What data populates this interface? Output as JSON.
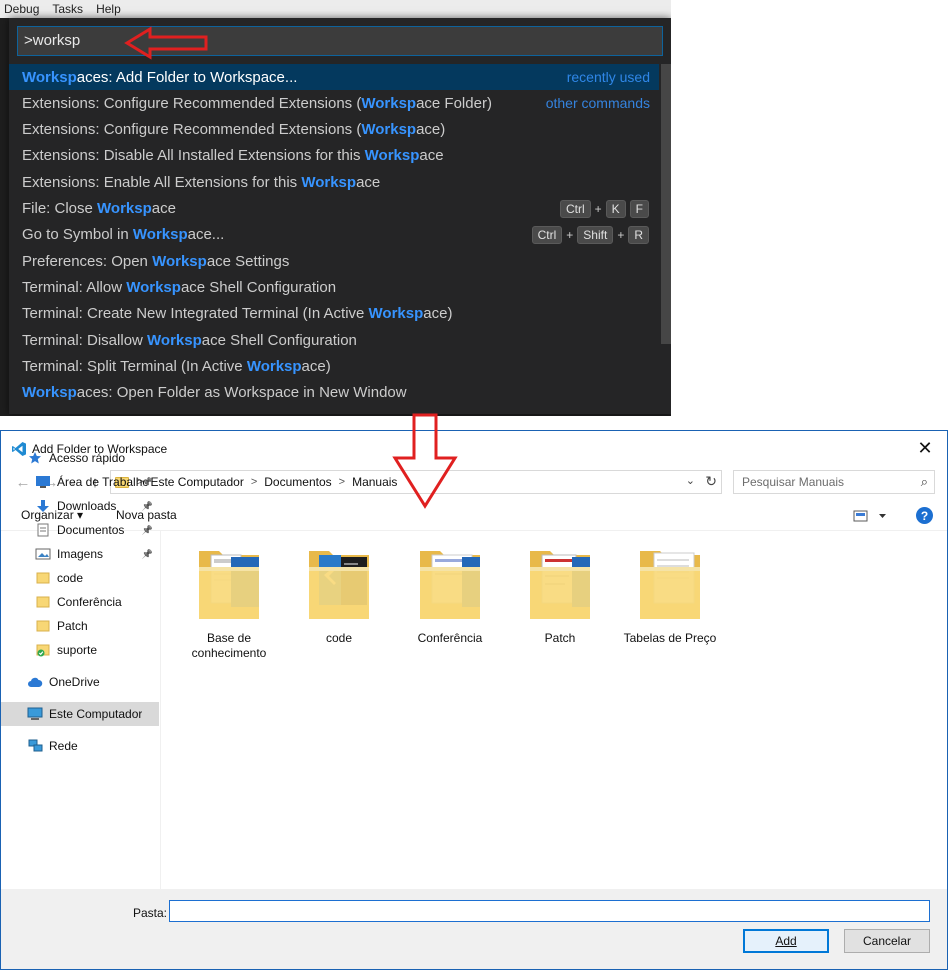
{
  "vscode": {
    "menu": [
      "Debug",
      "Tasks",
      "Help"
    ],
    "input_value": ">worksp",
    "commands": [
      {
        "pre": "",
        "hl": "Worksp",
        "post": "aces: Add Folder to Workspace...",
        "meta": "recently used",
        "keys": []
      },
      {
        "pre": "Extensions: Configure Recommended Extensions (",
        "hl": "Worksp",
        "post": "ace Folder)",
        "meta": "other commands",
        "keys": []
      },
      {
        "pre": "Extensions: Configure Recommended Extensions (",
        "hl": "Worksp",
        "post": "ace)",
        "meta": "",
        "keys": []
      },
      {
        "pre": "Extensions: Disable All Installed Extensions for this ",
        "hl": "Worksp",
        "post": "ace",
        "meta": "",
        "keys": []
      },
      {
        "pre": "Extensions: Enable All Extensions for this ",
        "hl": "Worksp",
        "post": "ace",
        "meta": "",
        "keys": []
      },
      {
        "pre": "File: Close ",
        "hl": "Worksp",
        "post": "ace",
        "meta": "",
        "keys": [
          "Ctrl",
          "K",
          "F"
        ]
      },
      {
        "pre": "Go to Symbol in ",
        "hl": "Worksp",
        "post": "ace...",
        "meta": "",
        "keys": [
          "Ctrl",
          "Shift",
          "R"
        ]
      },
      {
        "pre": "Preferences: Open ",
        "hl": "Worksp",
        "post": "ace Settings",
        "meta": "",
        "keys": []
      },
      {
        "pre": "Terminal: Allow ",
        "hl": "Worksp",
        "post": "ace Shell Configuration",
        "meta": "",
        "keys": []
      },
      {
        "pre": "Terminal: Create New Integrated Terminal (In Active ",
        "hl": "Worksp",
        "post": "ace)",
        "meta": "",
        "keys": []
      },
      {
        "pre": "Terminal: Disallow ",
        "hl": "Worksp",
        "post": "ace Shell Configuration",
        "meta": "",
        "keys": []
      },
      {
        "pre": "Terminal: Split Terminal (In Active ",
        "hl": "Worksp",
        "post": "ace)",
        "meta": "",
        "keys": []
      },
      {
        "pre": "",
        "hl": "Worksp",
        "post": "aces: Open Folder as Workspace in New Window",
        "meta": "",
        "keys": []
      }
    ]
  },
  "dialog": {
    "title": "Add Folder to Workspace",
    "close_glyph": "✕",
    "breadcrumbs": [
      "Este Computador",
      "Documentos",
      "Manuais"
    ],
    "search_placeholder": "Pesquisar Manuais",
    "toolbar": {
      "organize": "Organizar ▾",
      "new_folder": "Nova pasta",
      "help": "?"
    },
    "nav": [
      {
        "label": "Acesso rápido",
        "icon": "star-icon",
        "pinned": false
      },
      {
        "label": "Área de Trabalhc",
        "icon": "desktop-icon",
        "pinned": true
      },
      {
        "label": "Downloads",
        "icon": "download-icon",
        "pinned": true
      },
      {
        "label": "Documentos",
        "icon": "document-icon",
        "pinned": true
      },
      {
        "label": "Imagens",
        "icon": "picture-icon",
        "pinned": true
      },
      {
        "label": "code",
        "icon": "folder-icon",
        "pinned": false
      },
      {
        "label": "Conferência",
        "icon": "folder-icon",
        "pinned": false
      },
      {
        "label": "Patch",
        "icon": "folder-icon",
        "pinned": false
      },
      {
        "label": "suporte",
        "icon": "folder-sync-icon",
        "pinned": false
      },
      {
        "label": "OneDrive",
        "icon": "cloud-icon",
        "pinned": false
      },
      {
        "label": "Este Computador",
        "icon": "computer-icon",
        "pinned": false,
        "selected": true
      },
      {
        "label": "Rede",
        "icon": "network-icon",
        "pinned": false
      }
    ],
    "folders": [
      {
        "label": "Base de conhecimento"
      },
      {
        "label": "code"
      },
      {
        "label": "Conferência"
      },
      {
        "label": "Patch"
      },
      {
        "label": "Tabelas de Preço"
      }
    ],
    "footer": {
      "folder_label": "Pasta:",
      "folder_value": "",
      "add": "Add",
      "cancel": "Cancelar"
    }
  },
  "colors": {
    "accent": "#0078d7",
    "vscode_highlight": "#3794ff",
    "annotation": "#e02020"
  }
}
